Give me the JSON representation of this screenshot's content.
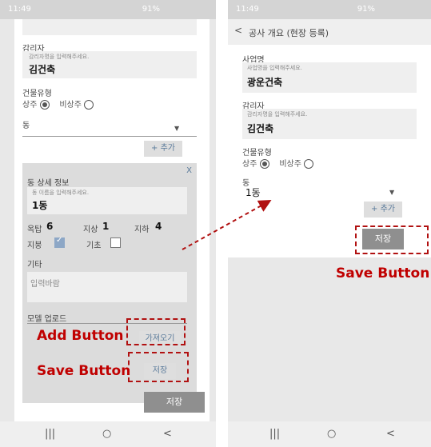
{
  "left": {
    "status": {
      "time": "11:49",
      "right": "91%"
    },
    "supervisor": {
      "label": "감리자",
      "hint": "감리자명을 입력해주세요.",
      "value": "김건축"
    },
    "building_type": {
      "label": "건물유형",
      "opt1": "상주",
      "opt2": "비상주"
    },
    "dong": {
      "label": "동"
    },
    "add_label": "+ 추가",
    "detail": {
      "close": "X",
      "title": "동 상세 정보",
      "name_hint": "동 이름을 입력해주세요.",
      "name_value": "1동",
      "floors_label": "옥탑",
      "floors_value": "6",
      "above_label": "지상",
      "above_value": "1",
      "below_label": "지하",
      "below_value": "4",
      "roof_label": "지붕",
      "base_label": "기초",
      "etc_label": "기타",
      "etc_placeholder": "입력바람",
      "upload_label": "모델 업로드",
      "import_label": "가져오기",
      "save_label": "저장"
    },
    "save_label": "저장",
    "annot_add": "Add Button",
    "annot_save": "Save Button"
  },
  "right": {
    "status": {
      "time": "11:49",
      "right": "91%"
    },
    "header": {
      "back": "<",
      "title": "공사 개요 (현장 등록)"
    },
    "company": {
      "label": "사업명",
      "hint": "사업명을 입력해주세요.",
      "value": "광운건축"
    },
    "supervisor": {
      "label": "감리자",
      "hint": "감리자명을 입력해주세요.",
      "value": "김건축"
    },
    "building_type": {
      "label": "건물유형",
      "opt1": "상주",
      "opt2": "비상주"
    },
    "dong": {
      "label": "동",
      "value": "1동"
    },
    "add_label": "+ 추가",
    "save_label": "저장",
    "annot_save": "Save Button"
  },
  "nav": {
    "recent": "|||",
    "home": "○",
    "back": "<"
  },
  "colors": {
    "annotation": "#c00000"
  }
}
